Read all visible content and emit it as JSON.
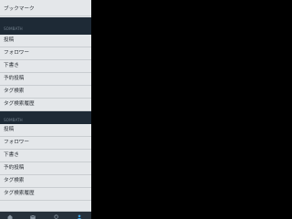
{
  "top_item": {
    "label": "ブックマーク"
  },
  "sections": [
    {
      "header": "SOMBATH",
      "items": [
        "投稿",
        "フォロワー",
        "下書き",
        "予約投稿",
        "タグ検索",
        "タグ検索履歴"
      ]
    },
    {
      "header": "SOMBATH",
      "items": [
        "投稿",
        "フォロワー",
        "下書き",
        "予約投稿",
        "タグ検索",
        "タグ検索履歴"
      ]
    }
  ],
  "colors": {
    "drawer_bg": "#e4e7ea",
    "header_bg": "#1e2a36",
    "page_bg": "#000000",
    "accent": "#3fa6e6"
  },
  "bottom_nav": {
    "icons": [
      "home-icon",
      "mail-icon",
      "search-icon",
      "profile-icon"
    ],
    "active_index": 3
  }
}
